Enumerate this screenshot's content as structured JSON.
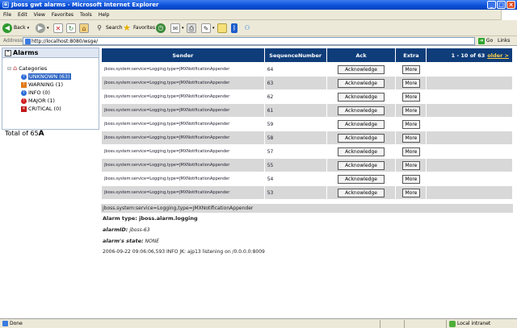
{
  "window": {
    "title": "Jboss gwt alarms - Microsoft Internet Explorer"
  },
  "menu": [
    "File",
    "Edit",
    "View",
    "Favorites",
    "Tools",
    "Help"
  ],
  "toolbar": {
    "back_label": "Back",
    "search_label": "Search",
    "favorites_label": "Favorites"
  },
  "address": {
    "label": "Address",
    "value": "http://localhost:8080/wsge/",
    "go_label": "Go",
    "links_label": "Links"
  },
  "sidebar": {
    "title": "Alarms",
    "root_label": "Categories",
    "categories": [
      {
        "label": "UNKNOWN (63)",
        "color": "#2f6fd8",
        "selected": true
      },
      {
        "label": "WARNING (1)",
        "color": "#e07a1a"
      },
      {
        "label": "INFO (0)",
        "color": "#2f6fd8"
      },
      {
        "label": "MAJOR (1)",
        "color": "#d02020"
      },
      {
        "label": "CRITICAL (0)",
        "color": "#c01818"
      }
    ],
    "total": "Total of 65"
  },
  "table": {
    "headers": {
      "sender": "Sender",
      "seq": "SequenceNumber",
      "ack": "Ack",
      "extra": "Extra"
    },
    "pager": {
      "text": "1 - 10 of 63",
      "older": "older >"
    },
    "ack_label": "Acknowledge",
    "more_label": "More",
    "rows": [
      {
        "sender": "jboss.system:service=Logging,type=JMXNotificationAppender",
        "seq": "64"
      },
      {
        "sender": "jboss.system:service=Logging,type=JMXNotificationAppender",
        "seq": "63"
      },
      {
        "sender": "jboss.system:service=Logging,type=JMXNotificationAppender",
        "seq": "62"
      },
      {
        "sender": "jboss.system:service=Logging,type=JMXNotificationAppender",
        "seq": "61"
      },
      {
        "sender": "jboss.system:service=Logging,type=JMXNotificationAppender",
        "seq": "59"
      },
      {
        "sender": "jboss.system:service=Logging,type=JMXNotificationAppender",
        "seq": "58"
      },
      {
        "sender": "jboss.system:service=Logging,type=JMXNotificationAppender",
        "seq": "57"
      },
      {
        "sender": "jboss.system:service=Logging,type=JMXNotificationAppender",
        "seq": "55"
      },
      {
        "sender": "jboss.system:service=Logging,type=JMXNotificationAppender",
        "seq": "54"
      },
      {
        "sender": "jboss.system:service=Logging,type=JMXNotificationAppender",
        "seq": "53"
      }
    ]
  },
  "detail": {
    "sender": "jboss.system:service=Logging,type=JMXNotificationAppender",
    "alarm_type": "Alarm type: jboss.alarm.logging",
    "alarm_id_label": "alarmID:",
    "alarm_id_value": "jboss-63",
    "alarm_state_label": "alarm's state:",
    "alarm_state_value": "NONE",
    "message": "2006-09-22 09:06:06,593 INFO JK: ajp13 listening on /0.0.0.0:8009"
  },
  "status": {
    "text": "Done",
    "zone": "Local intranet"
  }
}
